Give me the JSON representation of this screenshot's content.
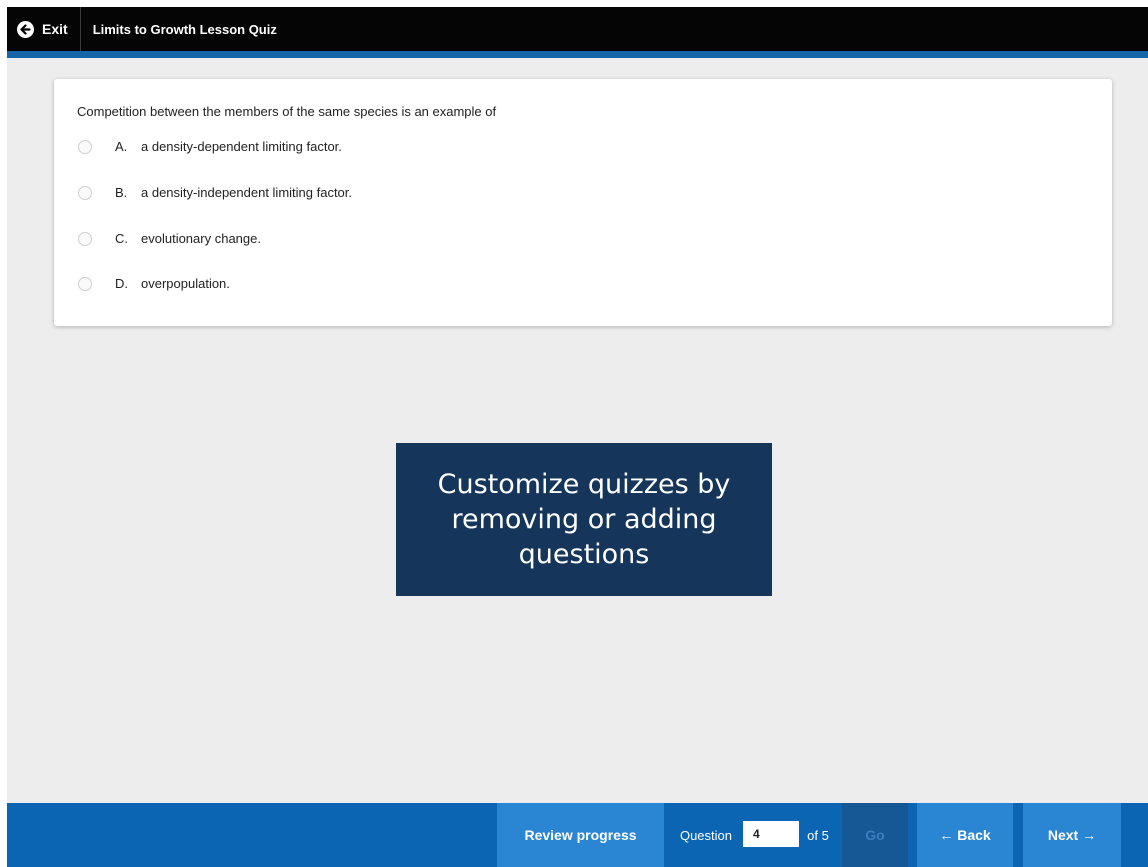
{
  "header": {
    "exit_label": "Exit",
    "quiz_title": "Limits to Growth Lesson Quiz"
  },
  "question": {
    "text": "Competition between the members of the same species is an example of",
    "options": [
      {
        "letter": "A.",
        "text": "a density-dependent limiting factor."
      },
      {
        "letter": "B.",
        "text": "a density-independent limiting factor."
      },
      {
        "letter": "C.",
        "text": "evolutionary change."
      },
      {
        "letter": "D.",
        "text": "overpopulation."
      }
    ]
  },
  "overlay": {
    "text": "Customize quizzes by removing or adding questions"
  },
  "footer": {
    "review_label": "Review progress",
    "question_label": "Question",
    "question_value": "4",
    "of_label": "of 5",
    "go_label": "Go",
    "back_label": "Back",
    "next_label": "Next"
  },
  "colors": {
    "top_bar": "#050505",
    "accent": "#1565a8",
    "bottom_bar": "#0b65b3",
    "button": "#2a86d3",
    "overlay": "#15355b"
  }
}
